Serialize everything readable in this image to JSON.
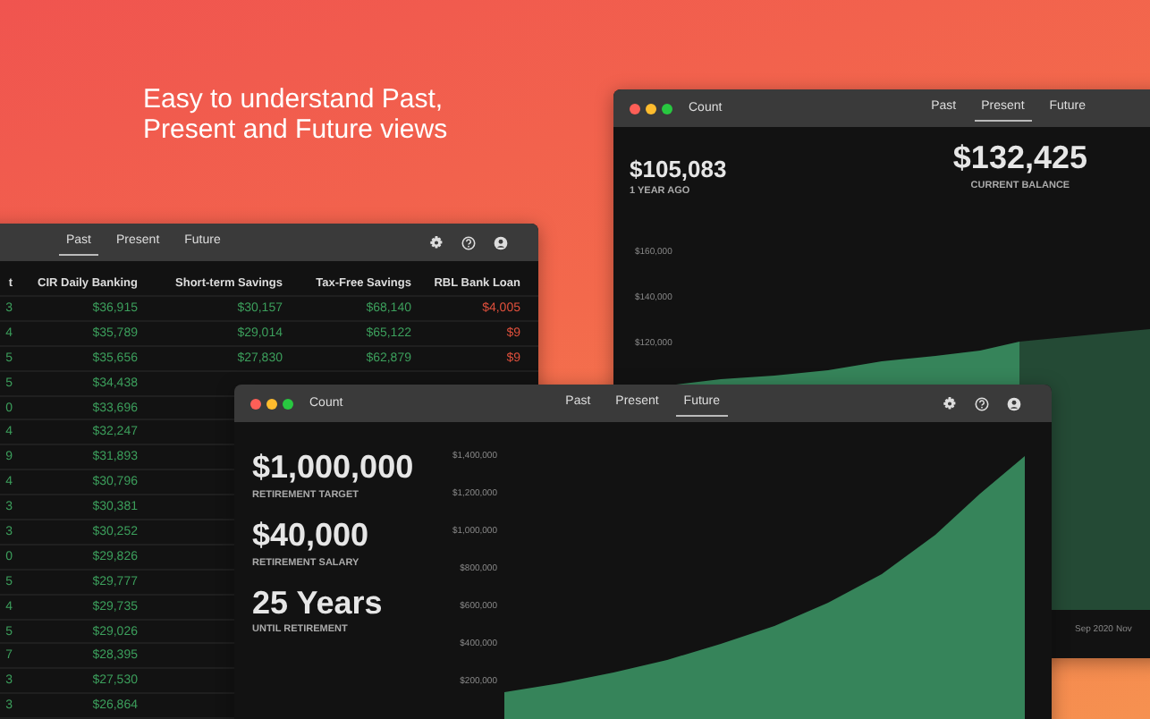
{
  "headline": "Easy to understand Past,\nPresent and Future views",
  "windows": [
    {
      "kind": "present",
      "title": "Count",
      "tabs": [
        {
          "label": "Past",
          "selected": false
        },
        {
          "label": "Present",
          "selected": true
        },
        {
          "label": "Future",
          "selected": false
        }
      ],
      "stats": [
        {
          "value": "$105,083",
          "label": "1 YEAR AGO"
        },
        {
          "value": "$132,425",
          "label": "CURRENT BALANCE"
        }
      ],
      "chart": {
        "y_labels": [
          "$160,000",
          "$140,000",
          "$120,000"
        ],
        "x_labels": [
          "Sep 2020",
          "Nov"
        ]
      }
    },
    {
      "kind": "past",
      "tabs": [
        {
          "label": "Past",
          "selected": true
        },
        {
          "label": "Present",
          "selected": false
        },
        {
          "label": "Future",
          "selected": false
        }
      ],
      "table": {
        "columns": [
          {
            "header": "t",
            "kind": "asset"
          },
          {
            "header": "CIR Daily Banking",
            "kind": "asset"
          },
          {
            "header": "Short-term Savings",
            "kind": "asset"
          },
          {
            "header": "Tax-Free Savings",
            "kind": "asset"
          },
          {
            "header": "RBL Bank Loan",
            "kind": "loan"
          }
        ],
        "rows": [
          [
            "3",
            "$36,915",
            "$30,157",
            "$68,140",
            "$4,005"
          ],
          [
            "4",
            "$35,789",
            "$29,014",
            "$65,122",
            "$9"
          ],
          [
            "5",
            "$35,656",
            "$27,830",
            "$62,879",
            "$9"
          ],
          [
            "5",
            "$34,438"
          ],
          [
            "0",
            "$33,696"
          ],
          [
            "4",
            "$32,247"
          ],
          [
            "9",
            "$31,893"
          ],
          [
            "4",
            "$30,796"
          ],
          [
            "3",
            "$30,381"
          ],
          [
            "3",
            "$30,252"
          ],
          [
            "0",
            "$29,826"
          ],
          [
            "5",
            "$29,777"
          ],
          [
            "4",
            "$29,735"
          ],
          [
            "5",
            "$29,026"
          ],
          [
            "7",
            "$28,395"
          ],
          [
            "3",
            "$27,530"
          ],
          [
            "3",
            "$26,864"
          ]
        ]
      }
    },
    {
      "kind": "future",
      "title": "Count",
      "tabs": [
        {
          "label": "Past",
          "selected": false
        },
        {
          "label": "Present",
          "selected": false
        },
        {
          "label": "Future",
          "selected": true
        }
      ],
      "stats": [
        {
          "value": "$1,000,000",
          "label": "RETIREMENT TARGET"
        },
        {
          "value": "$40,000",
          "label": "RETIREMENT SALARY"
        },
        {
          "value": "25 Years",
          "label": "UNTIL RETIREMENT"
        }
      ],
      "chart": {
        "y_labels": [
          "$1,400,000",
          "$1,200,000",
          "$1,000,000",
          "$800,000",
          "$600,000",
          "$400,000",
          "$200,000"
        ]
      }
    }
  ]
}
